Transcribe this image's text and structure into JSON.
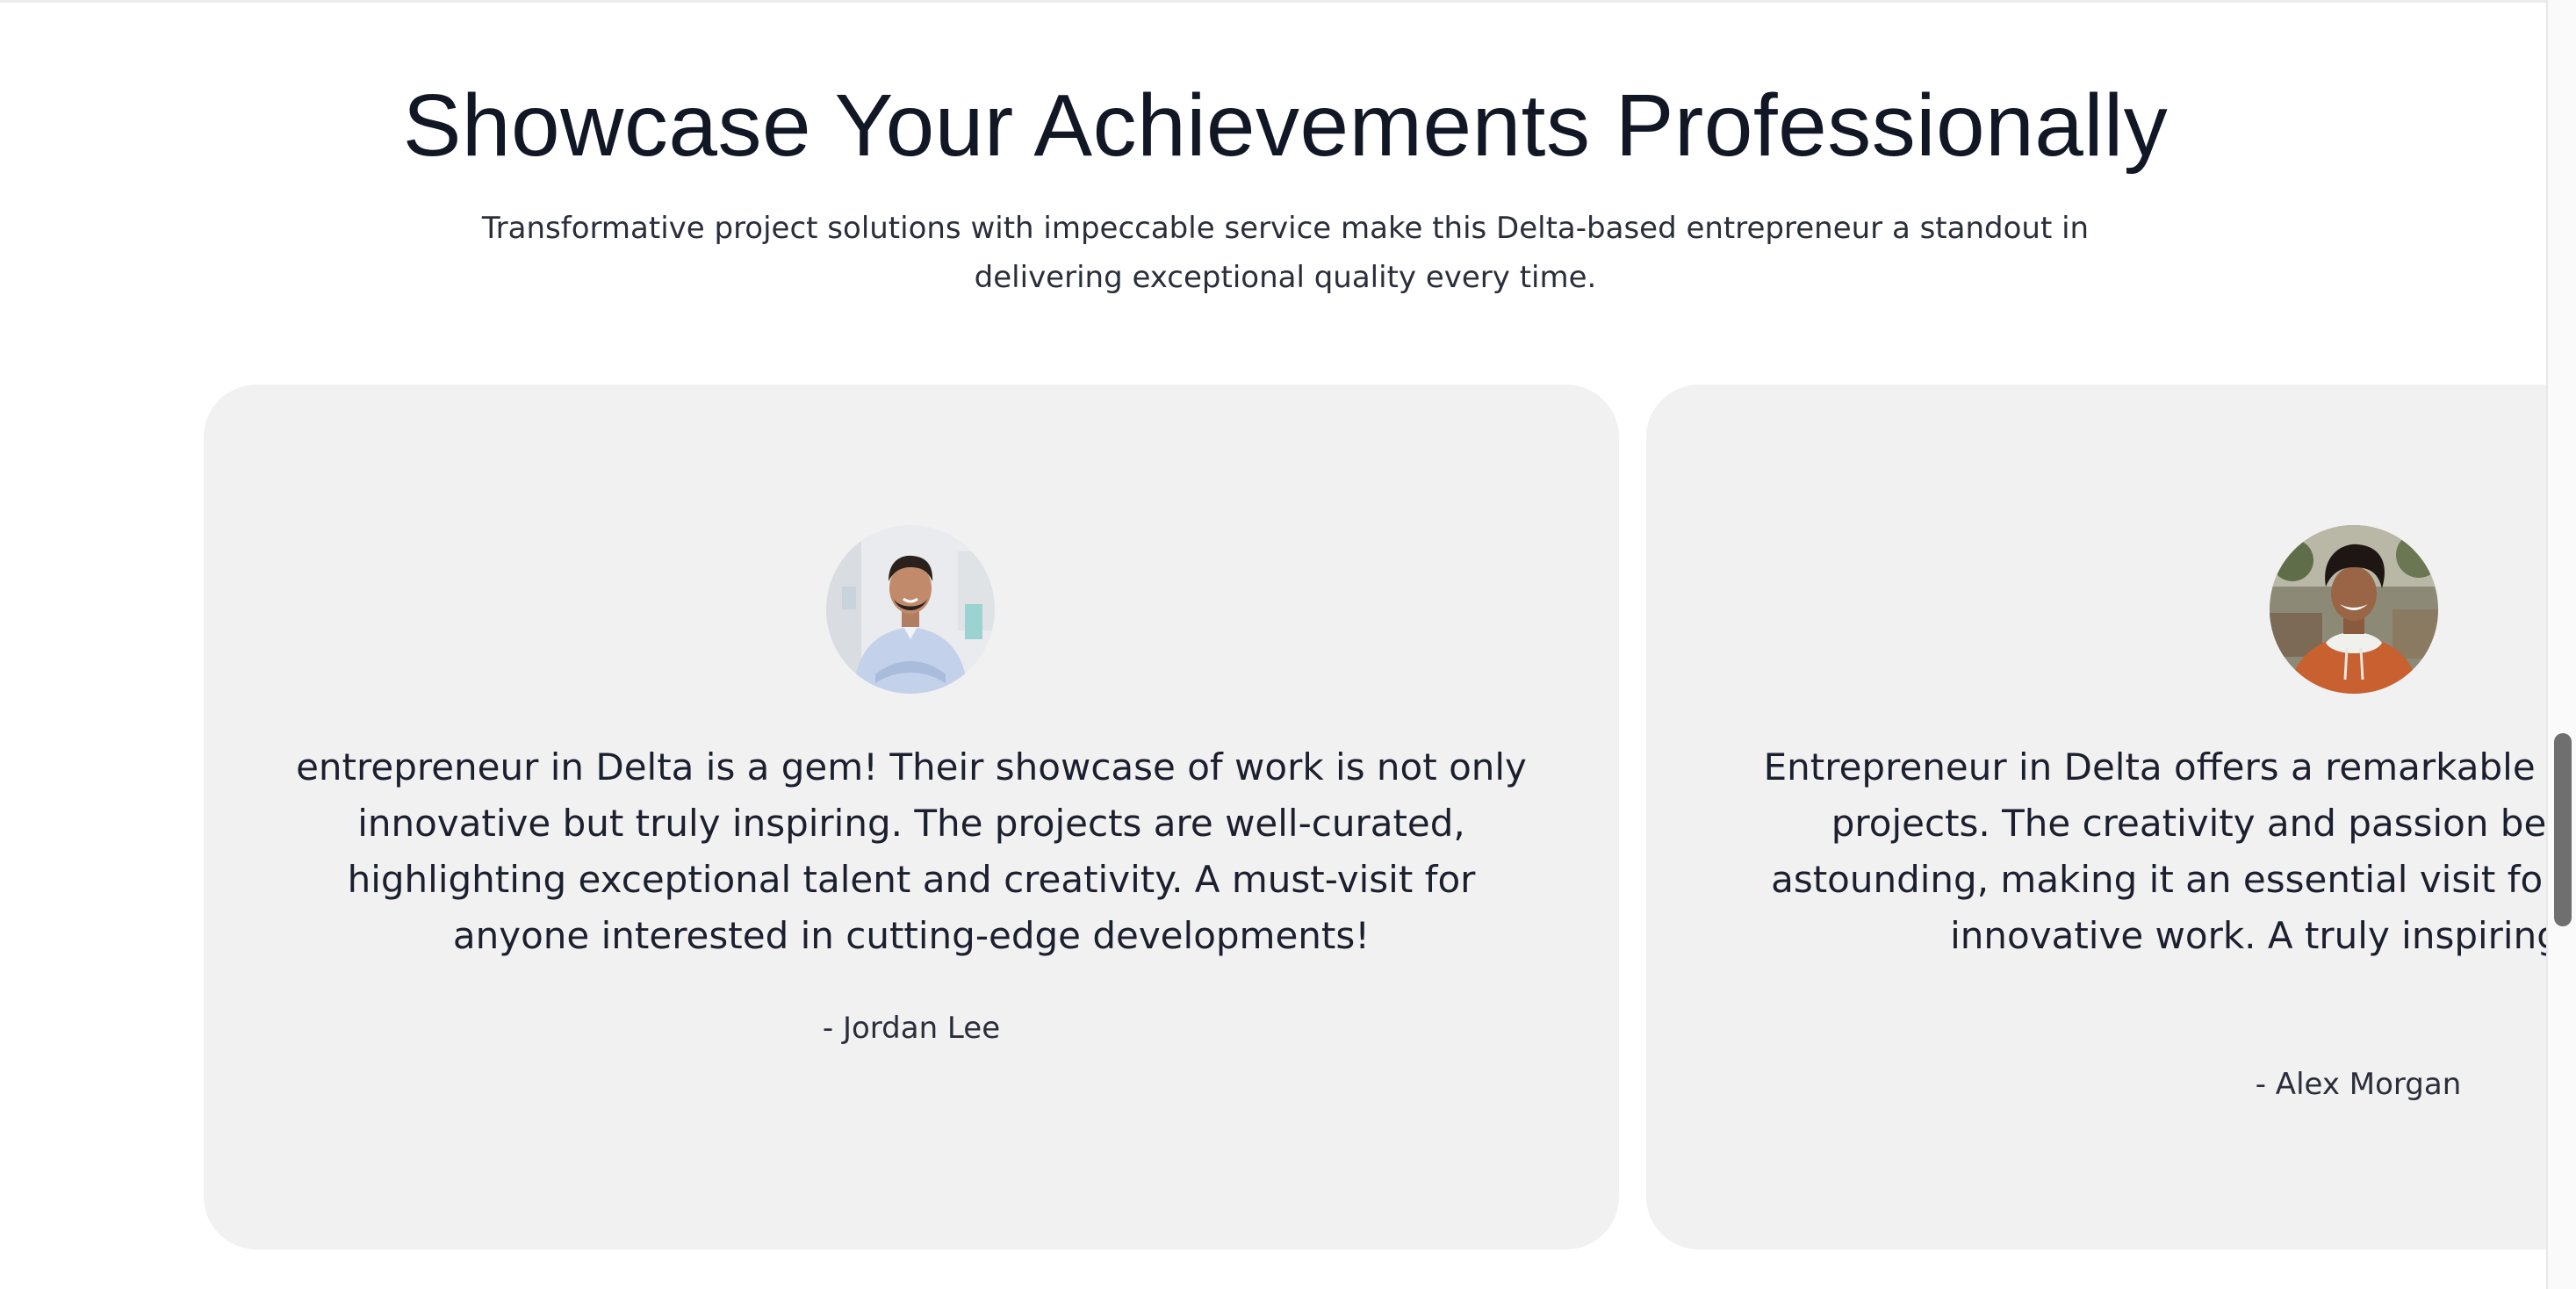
{
  "section": {
    "title": "Showcase Your Achievements Professionally",
    "subtitle": "Transformative project solutions with impeccable service make this Delta-based entrepreneur a standout in delivering exceptional quality every time."
  },
  "testimonials": [
    {
      "quote": "entrepreneur in Delta is a gem! Their showcase of work is not only innovative but truly inspiring. The projects are well-curated, highlighting exceptional talent and creativity. A must-visit for anyone interested in cutting-edge developments!",
      "author": "- Jordan Lee",
      "avatar_icon": "person-photo-avatar"
    },
    {
      "quote": "Entrepreneur in Delta offers a remarkable experience showcasing projects. The creativity and passion behind each piece are astounding, making it an essential visit for anyone curious about innovative work. A truly inspiring experience!",
      "author": "- Alex Morgan",
      "avatar_icon": "person-photo-avatar"
    }
  ],
  "colors": {
    "background": "#ffffff",
    "card": "#f1f1f1",
    "heading": "#121725",
    "text": "#1b1f2e"
  }
}
